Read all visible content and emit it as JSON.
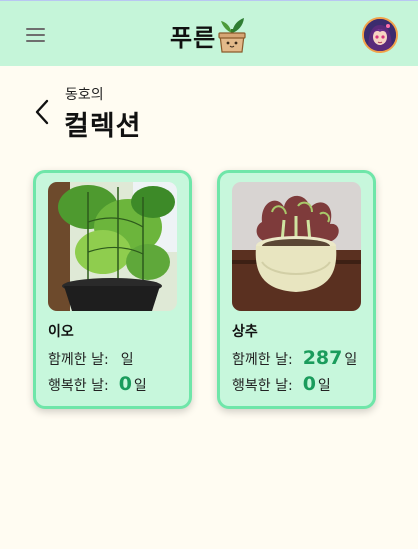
{
  "header": {
    "logo_text": "푸른",
    "logo_icon": "sprout-pot-icon",
    "menu_icon": "hamburger-menu-icon",
    "avatar_icon": "user-avatar"
  },
  "page": {
    "owner": "동호의",
    "title": "컬렉션",
    "back_icon": "chevron-left-icon"
  },
  "plants": [
    {
      "name": "이오",
      "together_label": "함께한 날:",
      "together_value": "",
      "together_unit": "일",
      "happy_label": "행복한 날:",
      "happy_value": "0",
      "happy_unit": "일",
      "photo": "cucumber-plant-photo"
    },
    {
      "name": "상추",
      "together_label": "함께한 날:",
      "together_value": "287",
      "together_unit": "일",
      "happy_label": "행복한 날:",
      "happy_value": "0",
      "happy_unit": "일",
      "photo": "lettuce-plant-photo"
    }
  ],
  "colors": {
    "header_bg": "#c5f5d9",
    "page_bg": "#fffcf2",
    "card_bg": "#c7f7dc",
    "card_border": "#6fe6a9",
    "accent_number": "#1a9c5c"
  }
}
